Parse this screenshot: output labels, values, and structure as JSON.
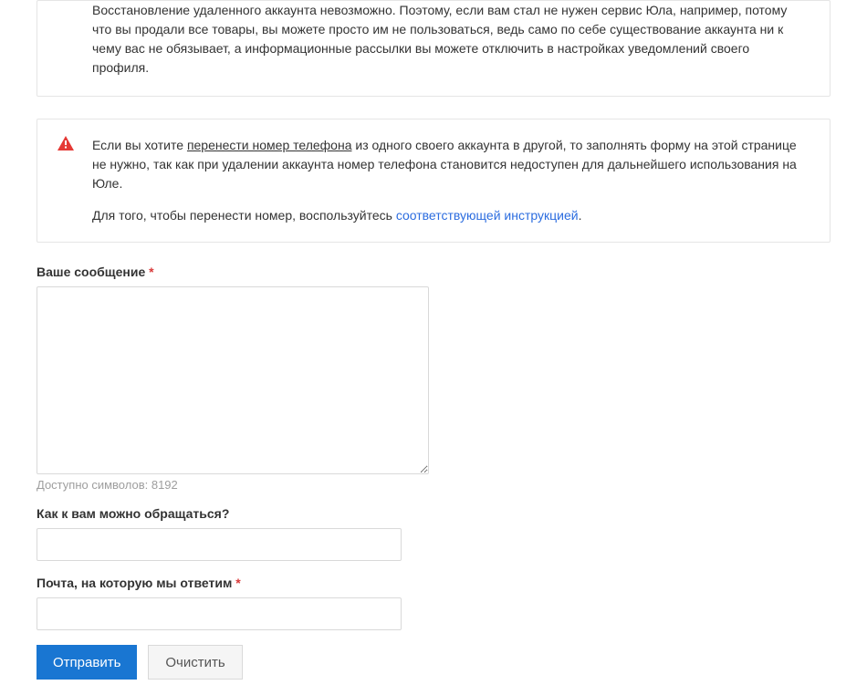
{
  "info": {
    "text": "Восстановление удаленного аккаунта невозможно. Поэтому, если вам стал не нужен сервис Юла, например, потому что вы продали все товары, вы можете просто им не пользоваться, ведь само по себе существование аккаунта ни к чему вас не обязывает, а информационные рассылки вы можете отключить в настройках уведомлений своего профиля."
  },
  "alert": {
    "p1_prefix": "Если вы хотите ",
    "p1_underline": "перенести номер телефона",
    "p1_suffix": " из одного своего аккаунта в другой, то заполнять форму на этой странице не нужно, так как при удалении аккаунта номер телефона становится недоступен для дальнейшего использования на Юле.",
    "p2_prefix": "Для того, чтобы перенести номер, воспользуйтесь ",
    "p2_link": "соответствующей инструкцией",
    "p2_suffix": "."
  },
  "form": {
    "message_label": "Ваше сообщение",
    "required_mark": "*",
    "message_value": "",
    "chars_hint": "Доступно символов: 8192",
    "name_label": "Как к вам можно обращаться?",
    "name_value": "",
    "email_label": "Почта, на которую мы ответим",
    "email_value": "",
    "submit_label": "Отправить",
    "reset_label": "Очистить"
  }
}
